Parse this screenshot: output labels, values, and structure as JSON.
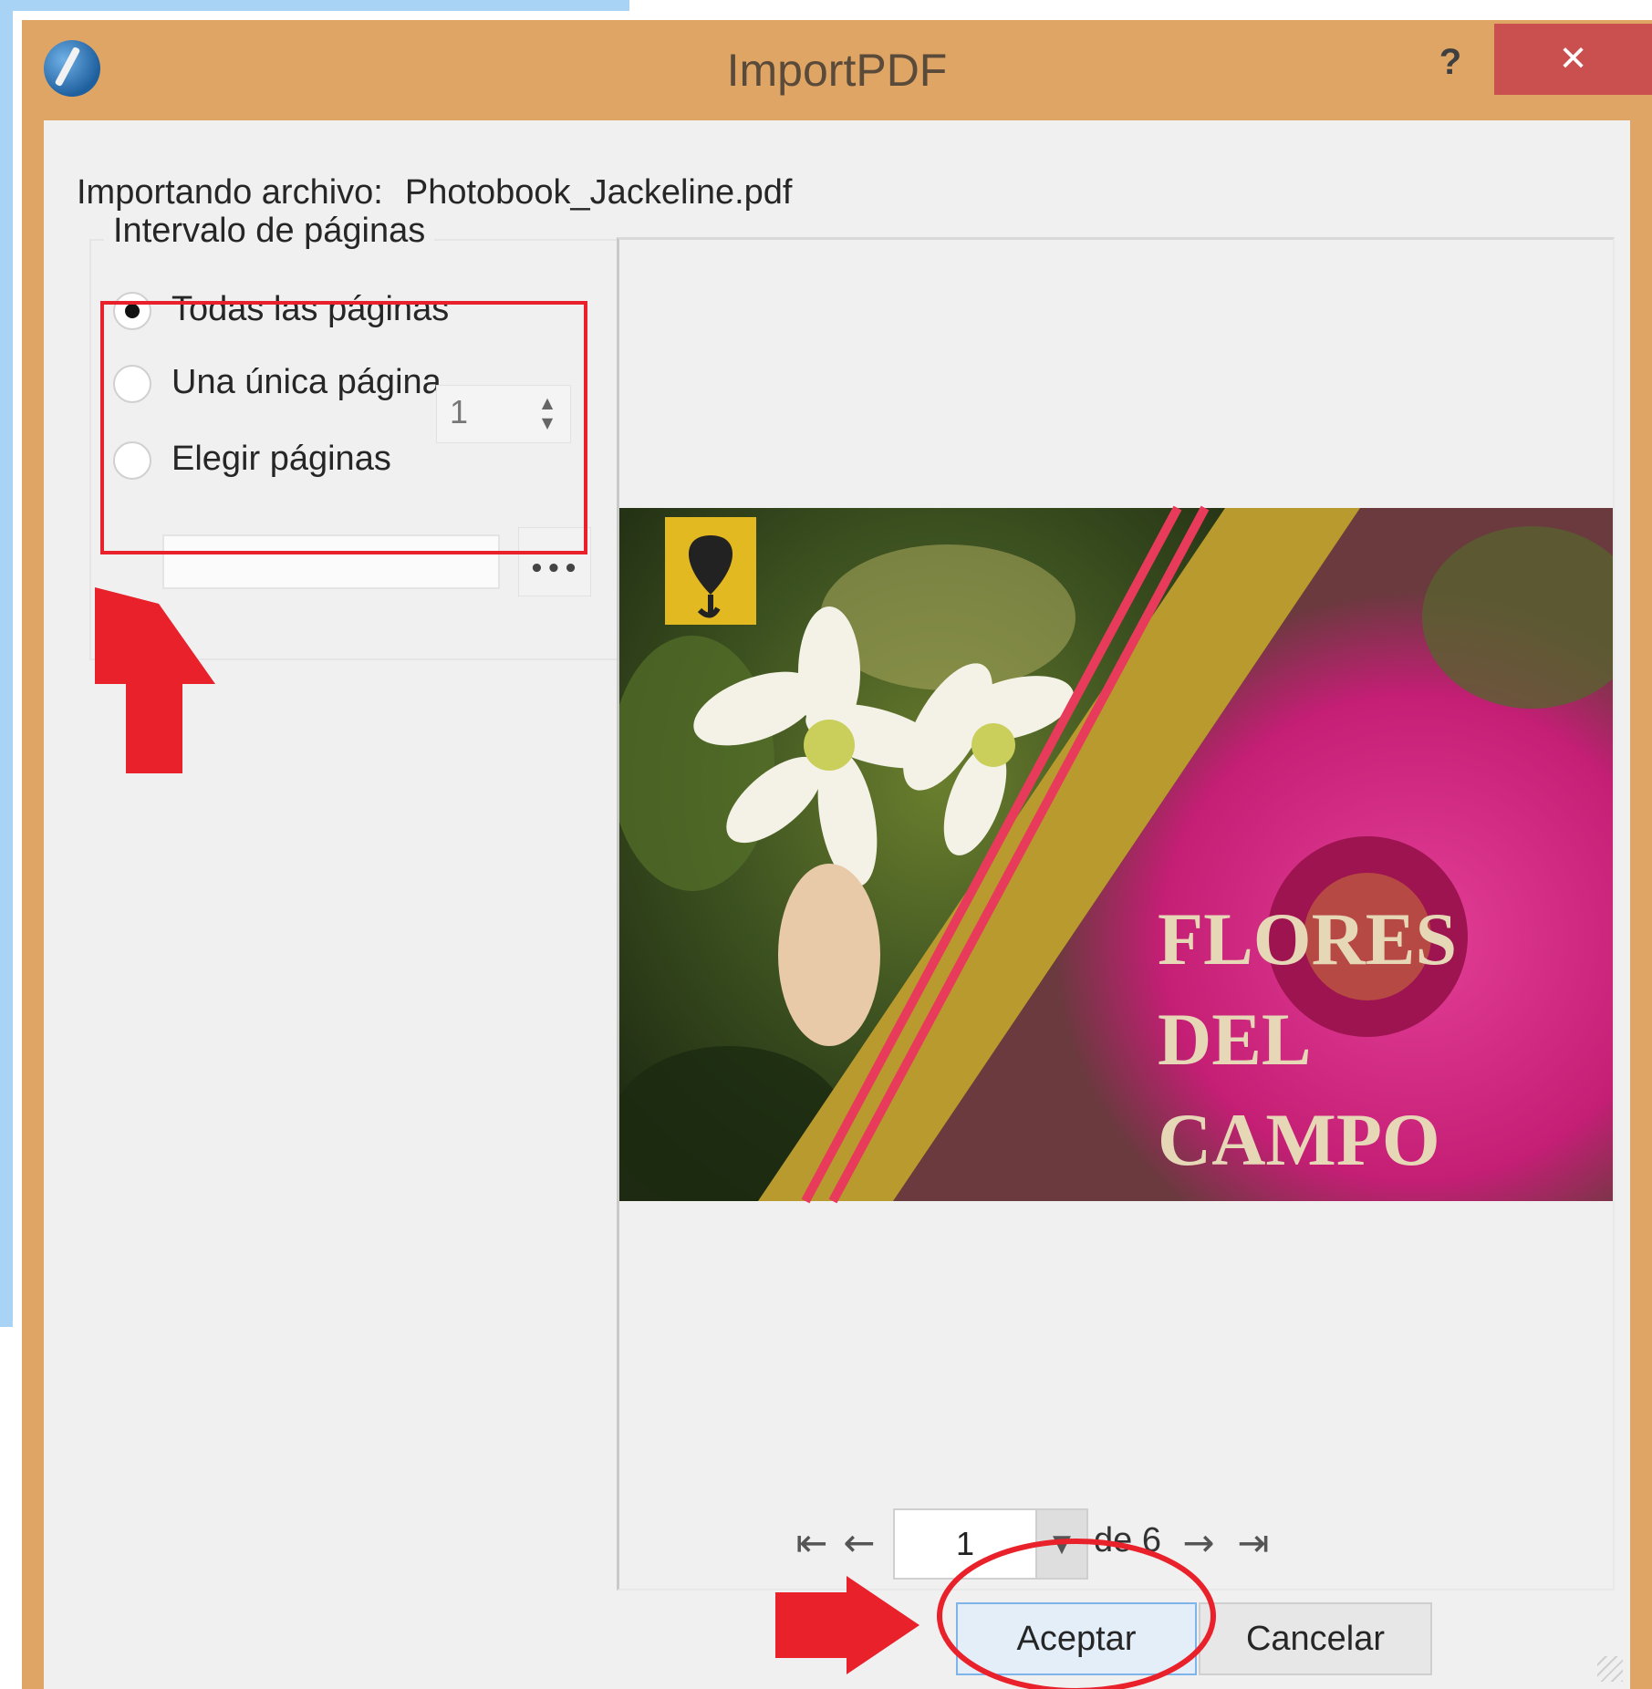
{
  "window": {
    "title": "ImportPDF",
    "help_label": "?",
    "close_label": "✕"
  },
  "file": {
    "label": "Importando archivo:",
    "name": "Photobook_Jackeline.pdf"
  },
  "page_range": {
    "title": "Intervalo de páginas",
    "options": [
      {
        "label": "Todas las páginas",
        "selected": true
      },
      {
        "label": "Una única página",
        "selected": false
      },
      {
        "label": "Elegir páginas",
        "selected": false
      }
    ],
    "single_page_value": "1",
    "browse_label": "•••"
  },
  "preview": {
    "cover_text": [
      "FLORES",
      "DEL",
      "CAMPO"
    ]
  },
  "navigation": {
    "first": "⇤",
    "prev": "←",
    "page": "1",
    "of_label": "de 6",
    "next": "→",
    "last": "⇥"
  },
  "buttons": {
    "ok": "Aceptar",
    "cancel": "Cancelar"
  },
  "colors": {
    "titlebar": "#dfa565",
    "close": "#c9504f",
    "annotation": "#e8212a"
  }
}
